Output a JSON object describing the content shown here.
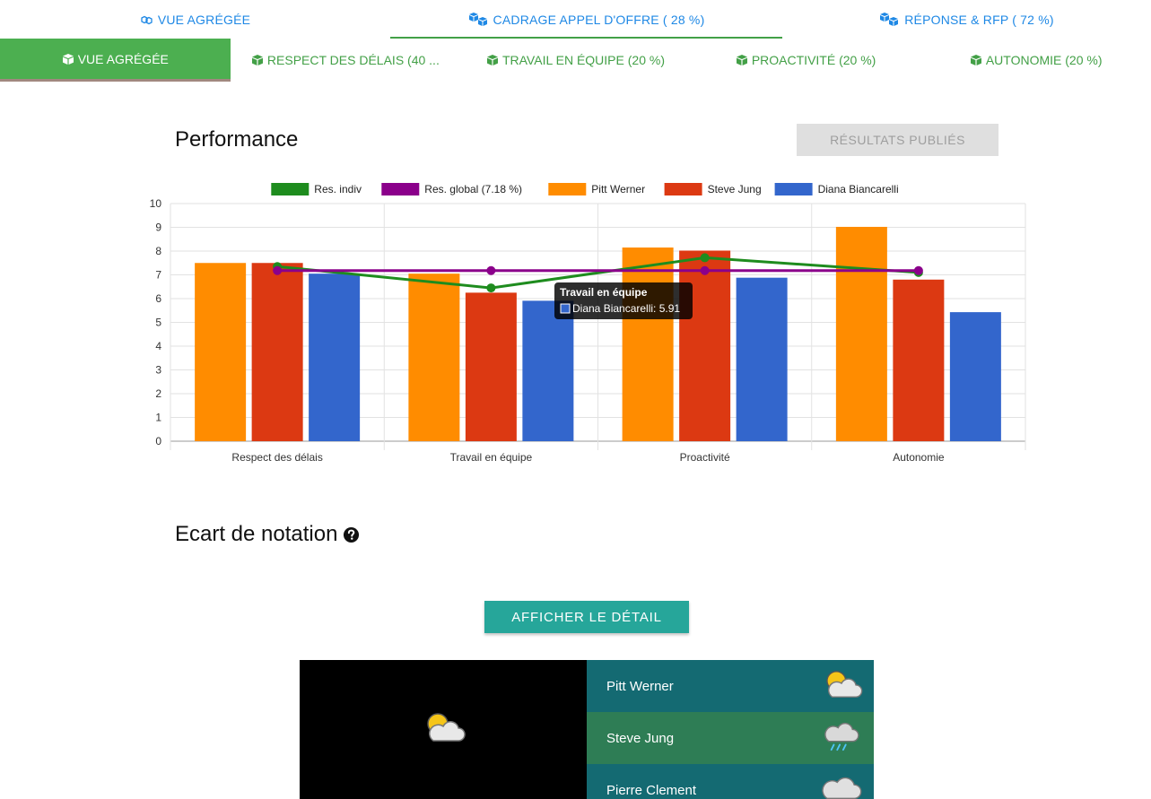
{
  "top_tabs": [
    {
      "label": "VUE AGRÉGÉE",
      "icon": "cubes-icon",
      "active": false
    },
    {
      "label": "CADRAGE APPEL D'OFFRE ( 28 %)",
      "icon": "cubes-icon",
      "active": true
    },
    {
      "label": "RÉPONSE & RFP ( 72 %)",
      "icon": "cubes-icon",
      "active": false
    }
  ],
  "sub_tabs": [
    {
      "label": "VUE AGRÉGÉE",
      "icon": "cube-icon",
      "active": true
    },
    {
      "label": "RESPECT DES DÉLAIS (40 ...",
      "icon": "cube-icon",
      "active": false
    },
    {
      "label": "TRAVAIL EN ÉQUIPE (20 %)",
      "icon": "cube-icon",
      "active": false
    },
    {
      "label": "PROACTIVITÉ (20 %)",
      "icon": "cube-icon",
      "active": false
    },
    {
      "label": "AUTONOMIE (20 %)",
      "icon": "cube-icon",
      "active": false
    }
  ],
  "performance": {
    "title": "Performance",
    "published_button": "RÉSULTATS PUBLIÉS"
  },
  "chart_data": {
    "type": "bar",
    "categories": [
      "Respect des délais",
      "Travail en équipe",
      "Proactivité",
      "Autonomie"
    ],
    "ylim": [
      0,
      10
    ],
    "yticks": [
      0,
      1,
      2,
      3,
      4,
      5,
      6,
      7,
      8,
      9,
      10
    ],
    "grid": true,
    "legend_position": "top",
    "series": [
      {
        "name": "Pitt Werner",
        "kind": "bar",
        "color": "#ff8c00",
        "values": [
          7.5,
          7.05,
          8.15,
          9.02
        ]
      },
      {
        "name": "Steve Jung",
        "kind": "bar",
        "color": "#dc3912",
        "values": [
          7.5,
          6.25,
          8.02,
          6.8
        ]
      },
      {
        "name": "Diana Biancarelli",
        "kind": "bar",
        "color": "#3366cc",
        "values": [
          7.05,
          5.91,
          6.88,
          5.43
        ]
      },
      {
        "name": "Res. indiv",
        "kind": "line",
        "color": "#1e8c1e",
        "values": [
          7.35,
          6.45,
          7.72,
          7.1
        ]
      },
      {
        "name": "Res. global (7.18 %)",
        "kind": "line",
        "color": "#8b008b",
        "values": [
          7.18,
          7.18,
          7.18,
          7.18
        ]
      }
    ],
    "legend": [
      "Res. indiv",
      "Res. global (7.18 %)",
      "Pitt Werner",
      "Steve Jung",
      "Diana Biancarelli"
    ],
    "tooltip": {
      "title": "Travail en équipe",
      "label": "Diana Biancarelli: 5.91"
    }
  },
  "ecart": {
    "title": "Ecart de notation",
    "detail_button": "AFFICHER LE DÉTAIL",
    "main_weather_icon": "sun-behind-cloud-icon",
    "rows": [
      {
        "name": "Pitt Werner",
        "icon": "sun-behind-cloud-icon",
        "color": "#146a72"
      },
      {
        "name": "Steve Jung",
        "icon": "rain-cloud-icon",
        "color": "#2e7d55"
      },
      {
        "name": "Pierre Clement",
        "icon": "cloud-icon",
        "color": "#146a72"
      }
    ]
  }
}
